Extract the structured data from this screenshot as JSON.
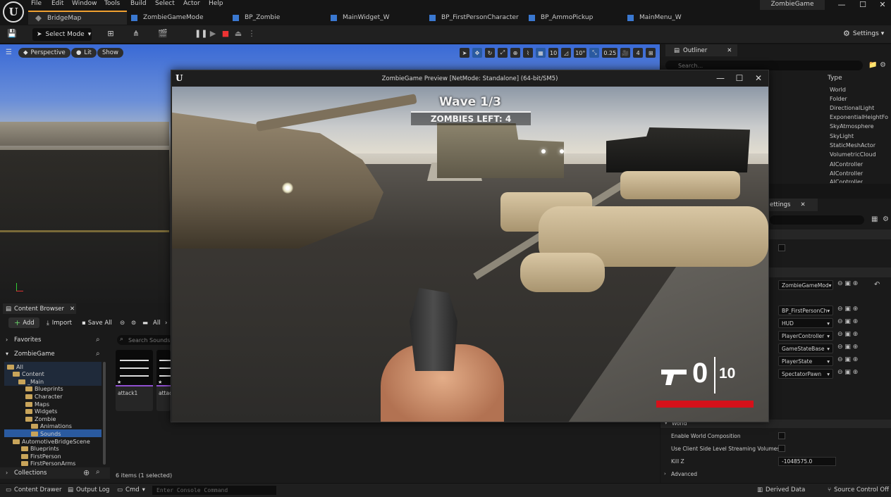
{
  "menu": [
    "File",
    "Edit",
    "Window",
    "Tools",
    "Build",
    "Select",
    "Actor",
    "Help"
  ],
  "project_name": "ZombieGame",
  "tabs": [
    "BridgeMap",
    "ZombieGameMode",
    "BP_Zombie",
    "MainWidget_W",
    "BP_FirstPersonCharacter",
    "BP_AmmoPickup",
    "MainMenu_W"
  ],
  "toolbar": {
    "select_mode": "Select Mode",
    "settings": "Settings"
  },
  "viewport": {
    "perspective": "Perspective",
    "lit": "Lit",
    "show": "Show",
    "grid_snap": "10",
    "rot_snap": "10°",
    "scale_snap": "0.25",
    "cam_speed": "4"
  },
  "outliner": {
    "tab": "Outliner",
    "search_placeholder": "Search...",
    "type_header": "Type",
    "types": [
      "World",
      "Folder",
      "DirectionalLight",
      "ExponentialHeightFo",
      "SkyAtmosphere",
      "SkyLight",
      "StaticMeshActor",
      "VolumetricCloud",
      "AIController",
      "AIController",
      "AIController"
    ]
  },
  "details": {
    "tab": "ettings",
    "game_mode": "ZombieGameMod",
    "classes": [
      "BP_FirstPersonCh",
      "HUD",
      "PlayerController",
      "GameStateBase",
      "PlayerState",
      "SpectatorPawn"
    ],
    "world_section": "World",
    "enable_world_composition": "Enable World Composition",
    "client_side_streaming": "Use Client Side Level Streaming Volumes",
    "kill_z_label": "Kill Z",
    "kill_z_value": "-1048575.0",
    "advanced": "Advanced"
  },
  "content_browser": {
    "tab": "Content Browser",
    "add": "Add",
    "import": "Import",
    "save_all": "Save All",
    "all": "All",
    "favorites": "Favorites",
    "root": "ZombieGame",
    "search_placeholder": "Search Sounds",
    "tree": [
      {
        "label": "All",
        "indent": 0
      },
      {
        "label": "Content",
        "indent": 1
      },
      {
        "label": "_Main",
        "indent": 2
      },
      {
        "label": "Blueprints",
        "indent": 3
      },
      {
        "label": "Character",
        "indent": 3
      },
      {
        "label": "Maps",
        "indent": 3
      },
      {
        "label": "Widgets",
        "indent": 3
      },
      {
        "label": "Zombie",
        "indent": 3
      },
      {
        "label": "Animations",
        "indent": 4
      },
      {
        "label": "Sounds",
        "indent": 4
      },
      {
        "label": "AutomotiveBridgeScene",
        "indent": 2
      },
      {
        "label": "Blueprints",
        "indent": 2
      },
      {
        "label": "FirstPerson",
        "indent": 2
      },
      {
        "label": "FirstPersonArms",
        "indent": 2
      }
    ],
    "assets": [
      "attack1",
      "attac"
    ],
    "collections": "Collections",
    "items_count": "6 items (1 selected)"
  },
  "statusbar": {
    "content_drawer": "Content Drawer",
    "output_log": "Output Log",
    "cmd": "Cmd",
    "console_placeholder": "Enter Console Command",
    "derived_data": "Derived Data",
    "source_control": "Source Control Off"
  },
  "game_window": {
    "title": "ZombieGame Preview [NetMode: Standalone]  (64-bit/SM5)",
    "wave": "Wave 1/3",
    "zombies_left": "ZOMBIES LEFT: 4",
    "ammo_current": "0",
    "ammo_max": "10",
    "health_fraction": 1.0
  },
  "colors": {
    "accent": "#f0a030",
    "health": "#d5111a",
    "selection": "#2a5aa0"
  }
}
